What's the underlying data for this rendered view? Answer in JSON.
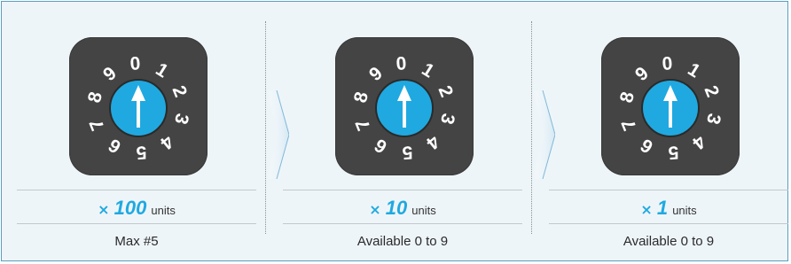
{
  "dial_digits": [
    "0",
    "1",
    "2",
    "3",
    "4",
    "5",
    "6",
    "7",
    "8",
    "9"
  ],
  "multiplier_symbol": "×",
  "unit_label": "units",
  "switches": [
    {
      "multiplier": "100",
      "caption": "Max #5"
    },
    {
      "multiplier": "10",
      "caption": "Available 0 to 9"
    },
    {
      "multiplier": "1",
      "caption": "Available 0 to 9"
    }
  ],
  "colors": {
    "accent": "#1fa9e0",
    "dial_body": "#444444",
    "panel_background": "#eef5f9",
    "panel_border": "#5a9fbe"
  }
}
